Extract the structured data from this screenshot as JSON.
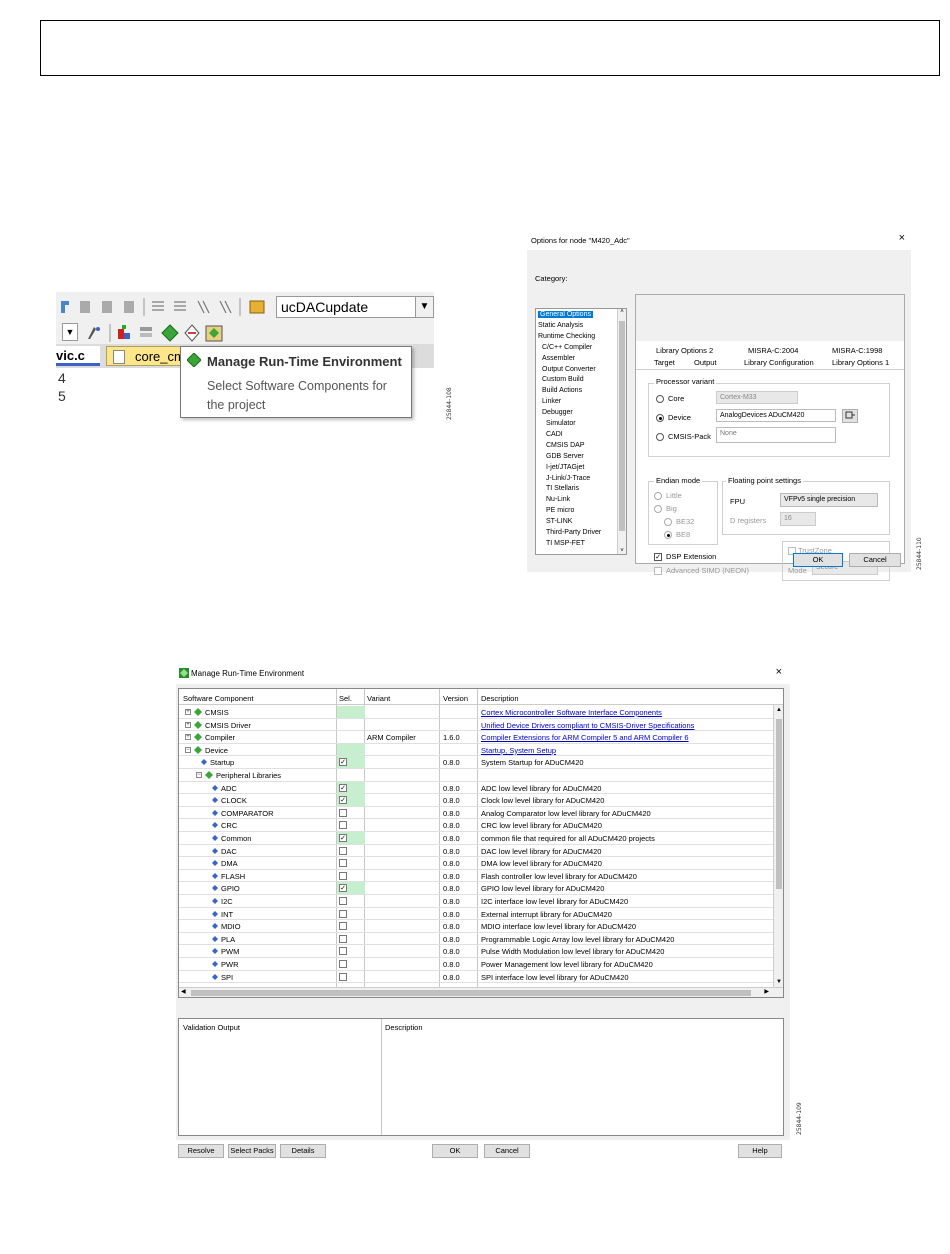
{
  "figure_labels": {
    "fig1": "25844-108",
    "fig2": "25844-110",
    "fig3": "25844-109"
  },
  "toolbar": {
    "target_combo": "ucDACupdate",
    "tab_active": "vic.c",
    "tab_file": "core_cm",
    "line_numbers": [
      "4",
      "5"
    ],
    "tooltip_title": "Manage Run-Time Environment",
    "tooltip_desc": "Select Software Components for the project"
  },
  "options_dialog": {
    "title": "Options for node \"M420_Adc\"",
    "close": "×",
    "category_label": "Category:",
    "categories": [
      {
        "label": "General Options",
        "indent": 0,
        "selected": true
      },
      {
        "label": "Static Analysis",
        "indent": 0
      },
      {
        "label": "Runtime Checking",
        "indent": 0
      },
      {
        "label": "C/C++ Compiler",
        "indent": 1
      },
      {
        "label": "Assembler",
        "indent": 1
      },
      {
        "label": "Output Converter",
        "indent": 1
      },
      {
        "label": "Custom Build",
        "indent": 1
      },
      {
        "label": "Build Actions",
        "indent": 1
      },
      {
        "label": "Linker",
        "indent": 1
      },
      {
        "label": "Debugger",
        "indent": 1
      },
      {
        "label": "Simulator",
        "indent": 2
      },
      {
        "label": "CADI",
        "indent": 2
      },
      {
        "label": "CMSIS DAP",
        "indent": 2
      },
      {
        "label": "GDB Server",
        "indent": 2
      },
      {
        "label": "I-jet/JTAGjet",
        "indent": 2
      },
      {
        "label": "J-Link/J-Trace",
        "indent": 2
      },
      {
        "label": "TI Stellaris",
        "indent": 2
      },
      {
        "label": "Nu-Link",
        "indent": 2
      },
      {
        "label": "PE micro",
        "indent": 2
      },
      {
        "label": "ST-LINK",
        "indent": 2
      },
      {
        "label": "Third-Party Driver",
        "indent": 2
      },
      {
        "label": "TI MSP-FET",
        "indent": 2
      }
    ],
    "tabs_row1": [
      "Library Options 2",
      "MISRA-C:2004",
      "MISRA-C:1998"
    ],
    "tabs_row2": [
      "Target",
      "Output",
      "Library Configuration",
      "Library Options 1"
    ],
    "processor_variant": "Processor variant",
    "core_label": "Core",
    "core_value": "Cortex-M33",
    "device_label": "Device",
    "device_value": "AnalogDevices ADuCM420",
    "cmsis_pack_label": "CMSIS-Pack",
    "cmsis_pack_value": "None",
    "endian_mode": "Endian mode",
    "endian_little": "Little",
    "endian_big": "Big",
    "be32": "BE32",
    "be8": "BE8",
    "fp_settings": "Floating point settings",
    "fpu_label": "FPU",
    "fpu_value": "VFPv5 single precision",
    "dregs_label": "D registers",
    "dregs_value": "16",
    "dsp_ext": "DSP Extension",
    "adv_simd": "Advanced SIMD (NEON)",
    "trustzone": "TrustZone",
    "mode_label": "Mode",
    "mode_value": "Secure",
    "ok": "OK",
    "cancel": "Cancel"
  },
  "rte": {
    "title": "Manage Run-Time Environment",
    "close": "×",
    "columns": [
      "Software Component",
      "Sel.",
      "Variant",
      "Version",
      "Description"
    ],
    "rows": [
      {
        "name": "CMSIS",
        "level": 0,
        "expander": "+",
        "sel": "none",
        "variant": "",
        "version": "",
        "desc": "Cortex Microcontroller Software Interface Components",
        "link": true
      },
      {
        "name": "CMSIS Driver",
        "level": 0,
        "expander": "+",
        "sel": "none",
        "variant": "",
        "version": "",
        "desc": "Unified Device Drivers compliant to CMSIS-Driver Specifications",
        "link": true
      },
      {
        "name": "Compiler",
        "level": 0,
        "expander": "+",
        "sel": "none",
        "variant": "ARM Compiler",
        "version": "1.6.0",
        "desc": "Compiler Extensions for ARM Compiler 5 and ARM Compiler 6",
        "link": true
      },
      {
        "name": "Device",
        "level": 0,
        "expander": "−",
        "sel": "none",
        "variant": "",
        "version": "",
        "desc": "Startup, System Setup",
        "link": true
      },
      {
        "name": "Startup",
        "level": 1,
        "expander": "",
        "sel": "checked",
        "variant": "",
        "version": "0.8.0",
        "desc": "System Startup for ADuCM420",
        "link": false
      },
      {
        "name": "Peripheral Libraries",
        "level": 1,
        "expander": "−",
        "sel": "none",
        "variant": "",
        "version": "",
        "desc": "",
        "link": false
      },
      {
        "name": "ADC",
        "level": 2,
        "expander": "",
        "sel": "checked",
        "variant": "",
        "version": "0.8.0",
        "desc": "ADC low level library for ADuCM420",
        "link": false
      },
      {
        "name": "CLOCK",
        "level": 2,
        "expander": "",
        "sel": "checked",
        "variant": "",
        "version": "0.8.0",
        "desc": "Clock low level library for ADuCM420",
        "link": false
      },
      {
        "name": "COMPARATOR",
        "level": 2,
        "expander": "",
        "sel": "unchecked",
        "variant": "",
        "version": "0.8.0",
        "desc": "Analog Comparator low level library for ADuCM420",
        "link": false
      },
      {
        "name": "CRC",
        "level": 2,
        "expander": "",
        "sel": "unchecked",
        "variant": "",
        "version": "0.8.0",
        "desc": "CRC low level library for ADuCM420",
        "link": false
      },
      {
        "name": "Common",
        "level": 2,
        "expander": "",
        "sel": "checked",
        "variant": "",
        "version": "0.8.0",
        "desc": "common file that required for all ADuCM420 projects",
        "link": false
      },
      {
        "name": "DAC",
        "level": 2,
        "expander": "",
        "sel": "unchecked",
        "variant": "",
        "version": "0.8.0",
        "desc": "DAC low level library for ADuCM420",
        "link": false
      },
      {
        "name": "DMA",
        "level": 2,
        "expander": "",
        "sel": "unchecked",
        "variant": "",
        "version": "0.8.0",
        "desc": "DMA low level library for ADuCM420",
        "link": false
      },
      {
        "name": "FLASH",
        "level": 2,
        "expander": "",
        "sel": "unchecked",
        "variant": "",
        "version": "0.8.0",
        "desc": "Flash controller low level library for ADuCM420",
        "link": false
      },
      {
        "name": "GPIO",
        "level": 2,
        "expander": "",
        "sel": "checked",
        "variant": "",
        "version": "0.8.0",
        "desc": "GPIO low level library for ADuCM420",
        "link": false
      },
      {
        "name": "I2C",
        "level": 2,
        "expander": "",
        "sel": "unchecked",
        "variant": "",
        "version": "0.8.0",
        "desc": "I2C interface low level library for ADuCM420",
        "link": false
      },
      {
        "name": "INT",
        "level": 2,
        "expander": "",
        "sel": "unchecked",
        "variant": "",
        "version": "0.8.0",
        "desc": "External interrupt library for ADuCM420",
        "link": false
      },
      {
        "name": "MDIO",
        "level": 2,
        "expander": "",
        "sel": "unchecked",
        "variant": "",
        "version": "0.8.0",
        "desc": "MDIO interface low level library for ADuCM420",
        "link": false
      },
      {
        "name": "PLA",
        "level": 2,
        "expander": "",
        "sel": "unchecked",
        "variant": "",
        "version": "0.8.0",
        "desc": "Programmable Logic Array low level library for ADuCM420",
        "link": false
      },
      {
        "name": "PWM",
        "level": 2,
        "expander": "",
        "sel": "unchecked",
        "variant": "",
        "version": "0.8.0",
        "desc": "Pulse Width Modulation low level library for ADuCM420",
        "link": false
      },
      {
        "name": "PWR",
        "level": 2,
        "expander": "",
        "sel": "unchecked",
        "variant": "",
        "version": "0.8.0",
        "desc": "Power Management low level library for ADuCM420",
        "link": false
      },
      {
        "name": "SPI",
        "level": 2,
        "expander": "",
        "sel": "unchecked",
        "variant": "",
        "version": "0.8.0",
        "desc": "SPI interface low level library for ADuCM420",
        "link": false
      }
    ],
    "validation_output": "Validation Output",
    "validation_desc": "Description",
    "buttons": {
      "resolve": "Resolve",
      "select_packs": "Select Packs",
      "details": "Details",
      "ok": "OK",
      "cancel": "Cancel",
      "help": "Help"
    }
  },
  "colors": {
    "selection_green": "#c6efce",
    "link_blue": "#0000cc",
    "tab_yellow": "#fde58a",
    "gem_green": "#3aa63a"
  }
}
